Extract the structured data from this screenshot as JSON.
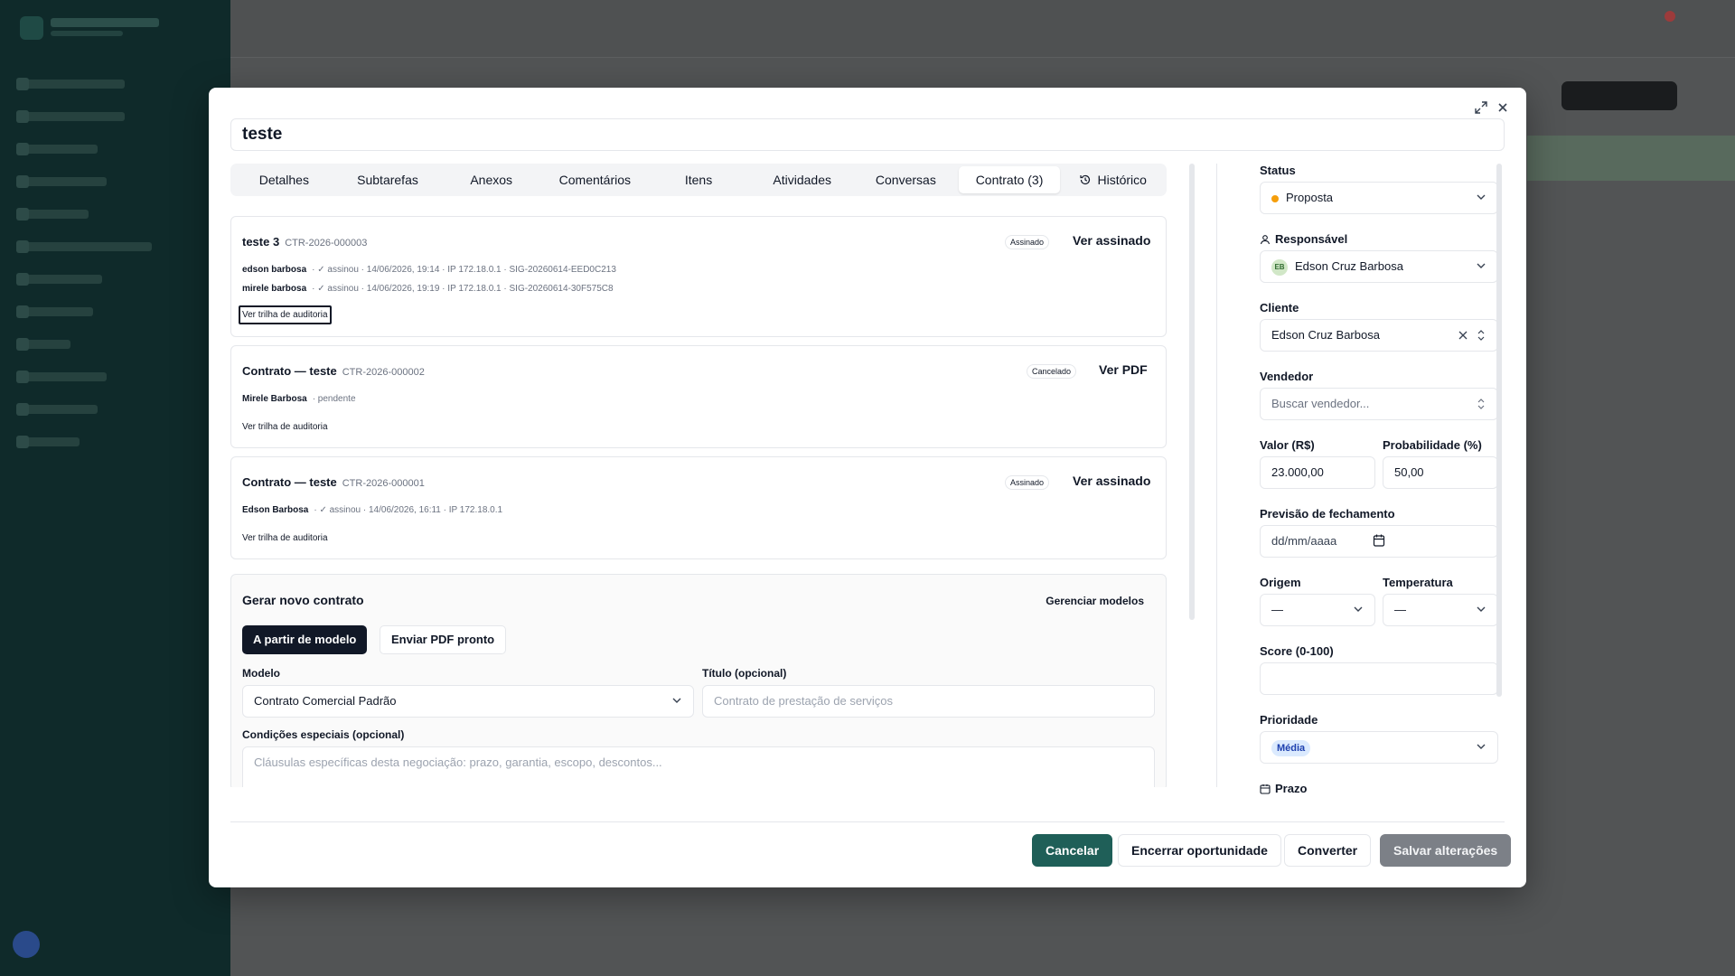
{
  "modal": {
    "title": "teste",
    "tabs": [
      "Detalhes",
      "Subtarefas",
      "Anexos",
      "Comentários",
      "Itens",
      "Atividades",
      "Conversas",
      "Contrato (3)",
      "Histórico"
    ],
    "active_tab": "Contrato (3)"
  },
  "contracts": [
    {
      "title": "teste 3",
      "code": "CTR-2026-000003",
      "badge": "Assinado",
      "action": "Ver assinado",
      "signatures": [
        {
          "name": "edson barbosa",
          "detail": "· ✓ assinou   · 14/06/2026, 19:14   · IP 172.18.0.1   · SIG-20260614-EED0C213"
        },
        {
          "name": "mirele barbosa",
          "detail": "· ✓ assinou   · 14/06/2026, 19:19   · IP 172.18.0.1   · SIG-20260614-30F575C8"
        }
      ],
      "audit_link": "Ver trilha de auditoria"
    },
    {
      "title": "Contrato — teste",
      "code": "CTR-2026-000002",
      "badge": "Cancelado",
      "action": "Ver PDF",
      "signatures": [
        {
          "name": "Mirele Barbosa",
          "detail": "· pendente"
        }
      ],
      "audit_link": "Ver trilha de auditoria"
    },
    {
      "title": "Contrato — teste",
      "code": "CTR-2026-000001",
      "badge": "Assinado",
      "action": "Ver assinado",
      "signatures": [
        {
          "name": "Edson Barbosa",
          "detail": "· ✓ assinou   · 14/06/2026, 16:11   · IP 172.18.0.1"
        }
      ],
      "audit_link": "Ver trilha de auditoria"
    }
  ],
  "generate": {
    "title": "Gerar novo contrato",
    "manage_link": "Gerenciar modelos",
    "mode_template": "A partir de modelo",
    "mode_pdf": "Enviar PDF pronto",
    "model_label": "Modelo",
    "model_value": "Contrato Comercial Padrão",
    "title_label": "Título (opcional)",
    "title_placeholder": "Contrato de prestação de serviços",
    "conditions_label": "Condições especiais (opcional)",
    "conditions_placeholder": "Cláusulas específicas desta negociação: prazo, garantia, escopo, descontos..."
  },
  "sidebar_fields": {
    "status_label": "Status",
    "status_value": "Proposta",
    "status_color": "#f59e0b",
    "responsavel_label": "Responsável",
    "responsavel_initials": "EB",
    "responsavel_value": "Edson Cruz Barbosa",
    "cliente_label": "Cliente",
    "cliente_value": "Edson Cruz Barbosa",
    "vendedor_label": "Vendedor",
    "vendedor_placeholder": "Buscar vendedor...",
    "valor_label": "Valor (R$)",
    "valor_value": "23.000,00",
    "prob_label": "Probabilidade (%)",
    "prob_value": "50,00",
    "previsao_label": "Previsão de fechamento",
    "previsao_placeholder": "dd/mm/aaaa",
    "origem_label": "Origem",
    "origem_value": "—",
    "temperatura_label": "Temperatura",
    "temperatura_value": "—",
    "score_label": "Score (0-100)",
    "score_value": "",
    "prioridade_label": "Prioridade",
    "prioridade_value": "Média",
    "prazo_label": "Prazo"
  },
  "footer": {
    "cancel": "Cancelar",
    "close_opportunity": "Encerrar oportunidade",
    "convert": "Converter",
    "save": "Salvar alterações"
  },
  "colors": {
    "primary": "#1f5f58",
    "dark": "#111827",
    "priority_pill": "#dbeafe"
  }
}
